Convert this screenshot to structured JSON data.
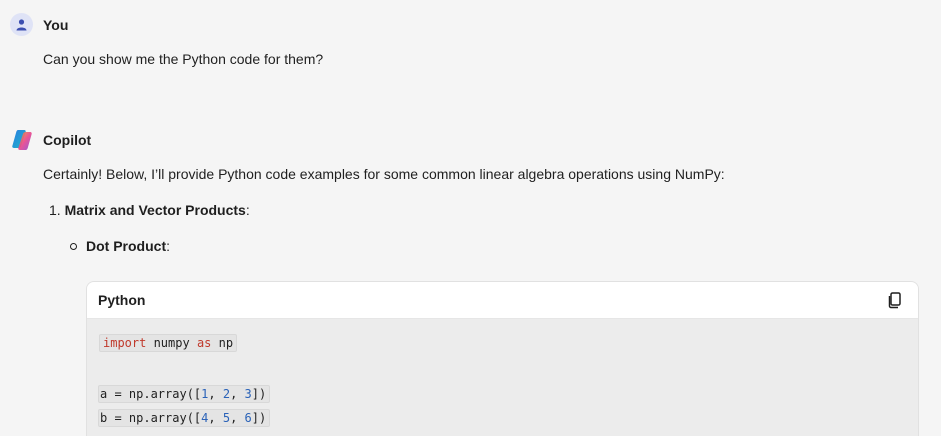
{
  "user": {
    "name": "You",
    "message": "Can you show me the Python code for them?"
  },
  "copilot": {
    "name": "Copilot",
    "intro": "Certainly! Below, I’ll provide Python code examples for some common linear algebra operations using NumPy:",
    "list_number": "1.",
    "list_item_bold": "Matrix and Vector Products",
    "list_item_suffix": ":",
    "bullet_bold": "Dot Product",
    "bullet_suffix": ":"
  },
  "code_block": {
    "language": "Python",
    "copy_icon": "copy-icon",
    "lines": {
      "l1": {
        "kw1": "import",
        "t1": " numpy ",
        "kw2": "as",
        "t2": " np"
      },
      "l2": {
        "t1": "a = np.array([",
        "n1": "1",
        "c1": ", ",
        "n2": "2",
        "c2": ", ",
        "n3": "3",
        "t2": "])"
      },
      "l3": {
        "t1": "b = np.array([",
        "n1": "4",
        "c1": ", ",
        "n2": "5",
        "c2": ", ",
        "n3": "6",
        "t2": "])"
      }
    }
  },
  "colors": {
    "background": "#f5f5f5",
    "keyword": "#c0392b",
    "number": "#2a62b8",
    "user_avatar": "#dfe3f6"
  }
}
